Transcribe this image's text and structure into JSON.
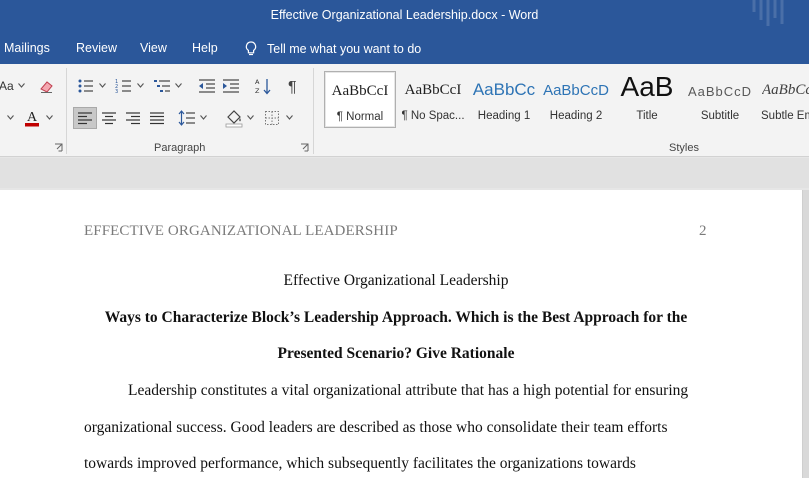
{
  "window": {
    "title": "Effective Organizational Leadership.docx  -  Word"
  },
  "ribbon_tabs": {
    "mailings": "Mailings",
    "review": "Review",
    "view": "View",
    "help": "Help",
    "tell_me": "Tell me what you want to do"
  },
  "groups": {
    "paragraph": "Paragraph",
    "styles": "Styles"
  },
  "font_group": {
    "partial_label": "Aa"
  },
  "styles_gallery": [
    {
      "preview": "AaBbCcI",
      "name": "¶ Normal"
    },
    {
      "preview": "AaBbCcI",
      "name": "¶ No Spac..."
    },
    {
      "preview": "AaBbCc",
      "name": "Heading 1"
    },
    {
      "preview": "AaBbCcD",
      "name": "Heading 2"
    },
    {
      "preview": "AaB",
      "name": "Title"
    },
    {
      "preview": "AaBbCcD",
      "name": "Subtitle"
    },
    {
      "preview": "AaBbCc",
      "name": "Subtle Em"
    }
  ],
  "colors": {
    "word_blue": "#2b579a",
    "heading_blue": "#2e74b5",
    "font_color_red": "#c00000",
    "highlight_yellow": "#ffff00"
  },
  "document": {
    "running_head": "EFFECTIVE ORGANIZATIONAL LEADERSHIP",
    "page_number": "2",
    "title": "Effective Organizational Leadership",
    "heading_line1": "Ways to Characterize Block’s Leadership Approach. Which is the Best Approach for the",
    "heading_line2": "Presented Scenario? Give Rationale",
    "para_line1": "Leadership constitutes a vital organizational attribute that has a high potential for ensuring",
    "para_line2": "organizational success. Good leaders are described as those who consolidate their team efforts",
    "para_line3": "towards improved performance, which subsequently facilitates the organizations towards"
  }
}
